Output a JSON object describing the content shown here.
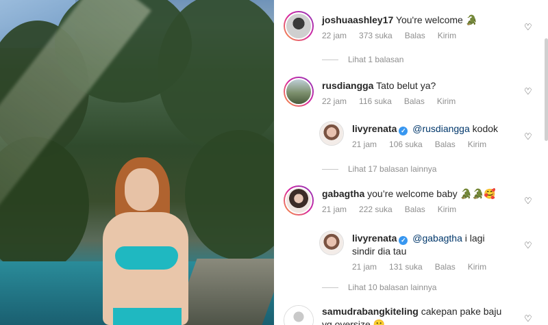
{
  "comments": [
    {
      "username": "joshuaashley17",
      "text": "You're welcome 🐊",
      "time": "22 jam",
      "likes": "373 suka",
      "reply": "Balas",
      "send": "Kirim"
    },
    {
      "view_replies": "Lihat 1 balasan"
    },
    {
      "username": "rusdiangga",
      "text": "Tato belut ya?",
      "time": "22 jam",
      "likes": "116 suka",
      "reply": "Balas",
      "send": "Kirim"
    },
    {
      "username": "livyrenata",
      "mention": "@rusdiangga",
      "text": "kodok",
      "time": "21 jam",
      "likes": "106 suka",
      "reply": "Balas",
      "send": "Kirim"
    },
    {
      "view_replies": "Lihat 17 balasan lainnya"
    },
    {
      "username": "gabagtha",
      "text": "you’re welcome baby 🐊🐊🥰",
      "time": "21 jam",
      "likes": "222 suka",
      "reply": "Balas",
      "send": "Kirim"
    },
    {
      "username": "livyrenata",
      "mention": "@gabagtha",
      "text_line1": "i lagi",
      "text_line2": "sindir dia tau",
      "time": "21 jam",
      "likes": "131 suka",
      "reply": "Balas",
      "send": "Kirim"
    },
    {
      "view_replies": "Lihat 10 balasan lainnya"
    },
    {
      "username": "samudrabangkiteling",
      "text_line1": "cakepan pake baju",
      "text_line2": "yg oversize 🤫"
    }
  ],
  "colors": {
    "verified": "#3897f0",
    "meta_text": "#8e8e8e",
    "mention": "#00376b"
  },
  "icons": {
    "like": "heart-outline-icon",
    "verified": "verified-badge-icon"
  }
}
